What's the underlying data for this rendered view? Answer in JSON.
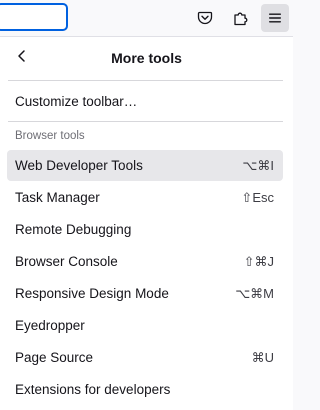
{
  "toolbar": {
    "url_value": "",
    "icons": [
      "pocket-icon",
      "extensions-icon",
      "hamburger-menu-icon"
    ]
  },
  "panel": {
    "title": "More tools",
    "back_icon": "chevron-left-icon",
    "customize_label": "Customize toolbar…",
    "section_label": "Browser tools",
    "items": [
      {
        "label": "Web Developer Tools",
        "shortcut": "⌥⌘I"
      },
      {
        "label": "Task Manager",
        "shortcut": "⇧Esc"
      },
      {
        "label": "Remote Debugging",
        "shortcut": ""
      },
      {
        "label": "Browser Console",
        "shortcut": "⇧⌘J"
      },
      {
        "label": "Responsive Design Mode",
        "shortcut": "⌥⌘M"
      },
      {
        "label": "Eyedropper",
        "shortcut": ""
      },
      {
        "label": "Page Source",
        "shortcut": "⌘U"
      },
      {
        "label": "Extensions for developers",
        "shortcut": ""
      }
    ]
  },
  "colors": {
    "focus_ring": "#0061e0",
    "active_item_bg": "#e7e7ea",
    "menu_button_bg": "#dfdfe3"
  }
}
